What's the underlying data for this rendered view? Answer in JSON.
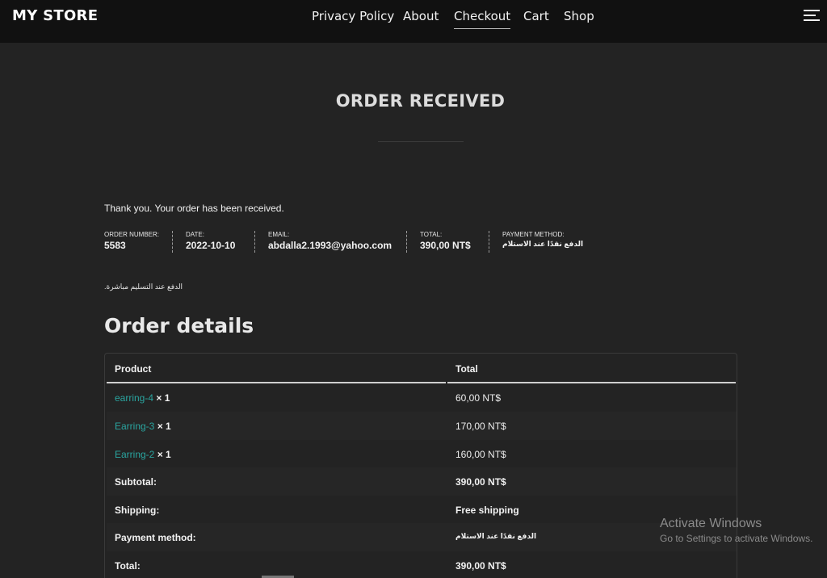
{
  "header": {
    "brand": "MY STORE",
    "nav": [
      {
        "label": "Privacy Policy"
      },
      {
        "label": "About"
      },
      {
        "label": "Checkout",
        "active": true
      },
      {
        "label": "Cart"
      },
      {
        "label": "Shop"
      }
    ],
    "menu_icon": "hamburger-menu-icon"
  },
  "page": {
    "title": "ORDER RECEIVED",
    "thanks": "Thank you. Your order has been received.",
    "payment_note": ".الدفع عند التسليم مباشرة"
  },
  "overview": {
    "order_number_label": "ORDER NUMBER:",
    "order_number": "5583",
    "date_label": "DATE:",
    "date": "2022-10-10",
    "email_label": "EMAIL:",
    "email": "abdalla2.1993@yahoo.com",
    "total_label": "TOTAL:",
    "total": "390,00 NT$",
    "payment_label": "PAYMENT METHOD:",
    "payment": "الدفع نقدًا عند الاستلام"
  },
  "details": {
    "title": "Order details",
    "col_product": "Product",
    "col_total": "Total",
    "items": [
      {
        "name": "earring-4",
        "qty": "× 1",
        "total": "60,00 NT$"
      },
      {
        "name": "Earring-3",
        "qty": "× 1",
        "total": "170,00 NT$"
      },
      {
        "name": "Earring-2",
        "qty": "× 1",
        "total": "160,00 NT$"
      }
    ],
    "subtotal_label": "Subtotal:",
    "subtotal": "390,00 NT$",
    "shipping_label": "Shipping:",
    "shipping": "Free shipping",
    "payment_label": "Payment method:",
    "payment": "الدفع نقدًا عند الاستلام",
    "total_label": "Total:",
    "total": "390,00 NT$"
  },
  "watermark": {
    "line1": "Activate Windows",
    "line2": "Go to Settings to activate Windows."
  },
  "colors": {
    "background": "#232323",
    "topbar": "#111111",
    "link": "#2aa5a0"
  }
}
